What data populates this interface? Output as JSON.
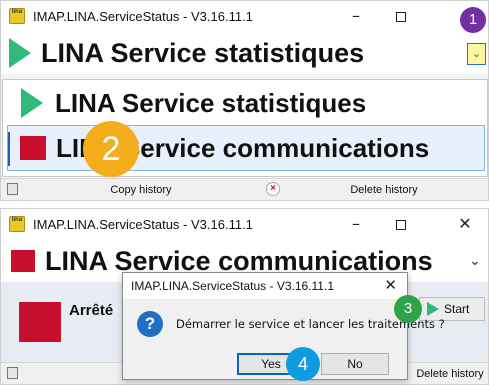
{
  "window_title": "IMAP.LINA.ServiceStatus - V3.16.11.1",
  "app_icon_text": "lina",
  "window_controls": {
    "minimize": "–",
    "close": "✕"
  },
  "top_window": {
    "selected_service": "LINA Service statistiques",
    "dropdown_arrow": "⌄",
    "dropdown_items": [
      {
        "label": "LINA Service statistiques",
        "state": "running"
      },
      {
        "label": "LINA Service communications",
        "state": "stopped"
      }
    ],
    "copy_history": "Copy history",
    "delete_history": "Delete history"
  },
  "bottom_window": {
    "selected_service": "LINA Service communications",
    "dropdown_arrow": "⌄",
    "status_text": "Arrêté",
    "start_label": "Start",
    "delete_history": "Delete history"
  },
  "dialog": {
    "title": "IMAP.LINA.ServiceStatus - V3.16.11.1",
    "message": "Démarrer le service et lancer les traitements ?",
    "icon": "?",
    "yes": "Yes",
    "no": "No",
    "close": "✕"
  },
  "badges": [
    "1",
    "2",
    "3",
    "4"
  ],
  "colors": {
    "running": "#2fba7a",
    "stopped": "#c8102e",
    "badge_1": "#7230a4",
    "badge_2": "#f5ae1b",
    "badge_3": "#2fa34a",
    "badge_4": "#0f9be0"
  }
}
